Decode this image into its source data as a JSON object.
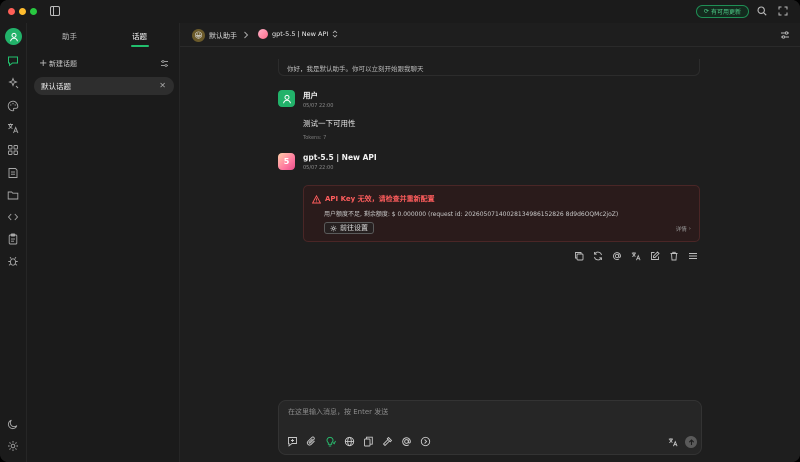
{
  "titlebar": {
    "update_label": "有可用更新"
  },
  "topics_panel": {
    "tabs": [
      {
        "label": "助手"
      },
      {
        "label": "话题"
      }
    ],
    "new_topic_label": "新建话题",
    "items": [
      {
        "label": "默认话题"
      }
    ]
  },
  "header": {
    "assistant_name": "默认助手",
    "assistant_emoji": "😀",
    "model_name": "gpt-5.5 | New API"
  },
  "chat": {
    "greeting": "你好，我是默认助手。你可以立刻开始跟我聊天",
    "messages": [
      {
        "role": "user",
        "name": "用户",
        "time": "05/07 22:00",
        "text": "测试一下可用性",
        "tokens": "Tokens: 7"
      },
      {
        "role": "assistant",
        "name": "gpt-5.5 | New API",
        "time": "05/07 22:00",
        "avatar_text": "5"
      }
    ],
    "error": {
      "title": "API Key 无效，请检查并重新配置",
      "description": "用户额度不足, 剩余额度: $ 0.000000 (request id: 20260507140028134986152826 8d9d6OQMc2joZ)",
      "button_label": "前往设置",
      "detail_label": "详情"
    }
  },
  "composer": {
    "placeholder": "在这里输入消息，按 Enter 发送"
  },
  "colors": {
    "accent_green": "#22b26a",
    "error_red": "#ff5d5d"
  }
}
